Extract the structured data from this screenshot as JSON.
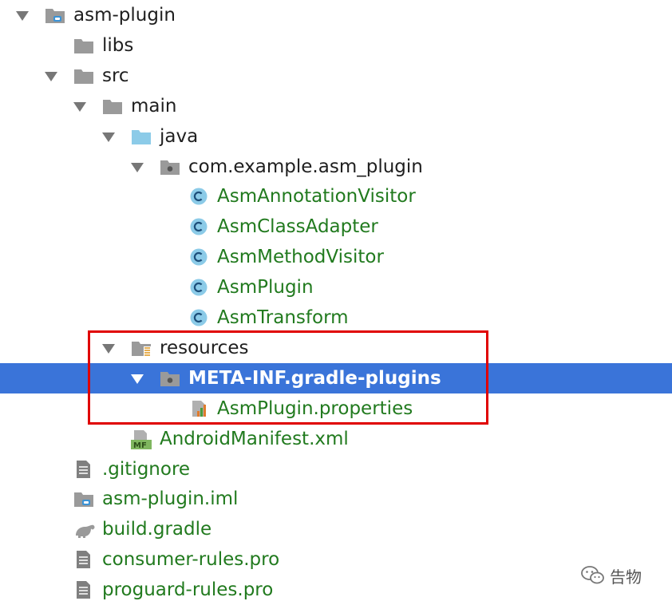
{
  "tree": [
    {
      "label": "asm-plugin",
      "level": 0,
      "arrow": true,
      "icon": "module-folder-icon",
      "green": false
    },
    {
      "label": "libs",
      "level": 1,
      "arrow": false,
      "icon": "folder-icon",
      "green": false
    },
    {
      "label": "src",
      "level": 1,
      "arrow": true,
      "icon": "folder-icon",
      "green": false
    },
    {
      "label": "main",
      "level": 2,
      "arrow": true,
      "icon": "folder-icon",
      "green": false
    },
    {
      "label": "java",
      "level": 3,
      "arrow": true,
      "icon": "source-folder-icon",
      "green": false
    },
    {
      "label": "com.example.asm_plugin",
      "level": 4,
      "arrow": true,
      "icon": "package-icon",
      "green": false
    },
    {
      "label": "AsmAnnotationVisitor",
      "level": 5,
      "arrow": false,
      "icon": "class-icon",
      "green": true
    },
    {
      "label": "AsmClassAdapter",
      "level": 5,
      "arrow": false,
      "icon": "class-icon",
      "green": true
    },
    {
      "label": "AsmMethodVisitor",
      "level": 5,
      "arrow": false,
      "icon": "class-icon",
      "green": true
    },
    {
      "label": "AsmPlugin",
      "level": 5,
      "arrow": false,
      "icon": "class-icon",
      "green": true
    },
    {
      "label": "AsmTransform",
      "level": 5,
      "arrow": false,
      "icon": "class-icon",
      "green": true
    },
    {
      "label": "resources",
      "level": 3,
      "arrow": true,
      "icon": "resources-folder-icon",
      "green": false
    },
    {
      "label": "META-INF.gradle-plugins",
      "level": 4,
      "arrow": true,
      "icon": "package-icon",
      "green": false,
      "selected": true
    },
    {
      "label": "AsmPlugin.properties",
      "level": 5,
      "arrow": false,
      "icon": "properties-file-icon",
      "green": true
    },
    {
      "label": "AndroidManifest.xml",
      "level": 3,
      "arrow": false,
      "icon": "manifest-file-icon",
      "green": true
    },
    {
      "label": ".gitignore",
      "level": 1,
      "arrow": false,
      "icon": "text-file-icon",
      "green": true
    },
    {
      "label": "asm-plugin.iml",
      "level": 1,
      "arrow": false,
      "icon": "module-folder-icon",
      "green": true
    },
    {
      "label": "build.gradle",
      "level": 1,
      "arrow": false,
      "icon": "gradle-icon",
      "green": true
    },
    {
      "label": "consumer-rules.pro",
      "level": 1,
      "arrow": false,
      "icon": "text-file-icon",
      "green": true
    },
    {
      "label": "proguard-rules.pro",
      "level": 1,
      "arrow": false,
      "icon": "text-file-icon",
      "green": true
    }
  ],
  "watermark": {
    "text": "告物"
  },
  "colors": {
    "selection": "#3a74d9",
    "vcs_added": "#217a1e",
    "highlight_box": "#e00000"
  }
}
